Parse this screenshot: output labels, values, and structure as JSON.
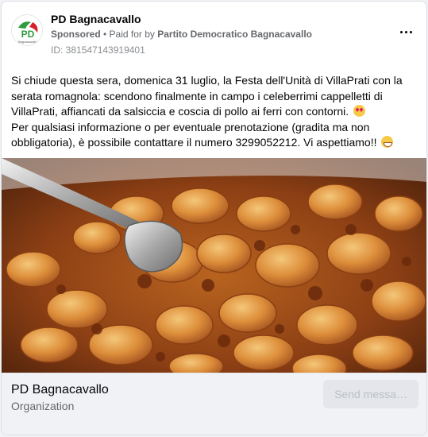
{
  "post": {
    "page_name": "PD Bagnacavallo",
    "sponsored_label": "Sponsored",
    "separator": " • ",
    "paid_for_prefix": "Paid for by ",
    "paid_for_by": "Partito Democratico Bagnacavallo",
    "ad_id": "ID: 381547143919401",
    "more_icon": "more-horizontal-icon",
    "avatar_logo": "pd-logo",
    "avatar_text": "PD",
    "avatar_caption": "Bagnacavallo",
    "body_paragraph_1": "Si chiude questa sera, domenica 31 luglio, la Festa dell'Unità di VillaPrati con la serata romagnola: scendono finalmente in campo i celeberrimi cappelletti di VillaPrati, affiancati da salsiccia e coscia di pollo ai ferri con contorni.",
    "body_paragraph_1_emoji": "smiling-face-with-heart-eyes",
    "body_paragraph_2": "Per qualsiasi informazione o per eventuale prenotazione (gradita ma non obbligatoria), è possibile contattare il numero 3299052212. Vi aspettiamo!!",
    "body_paragraph_2_emoji": "grinning-face",
    "image_subject": "cappelletti-with-ragu-and-serving-spoon"
  },
  "footer": {
    "title": "PD Bagnacavallo",
    "category": "Organization",
    "send_button_label": "Send messa…"
  },
  "colors": {
    "pd_green": "#2e9b3e",
    "pd_red": "#d62027",
    "text_secondary": "#65676b",
    "footer_bg": "#f0f2f5"
  }
}
